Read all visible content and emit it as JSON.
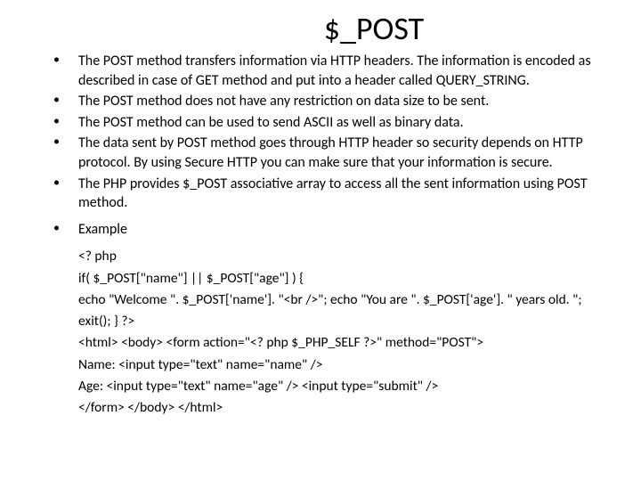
{
  "title": "$_POST",
  "bullets": [
    "The POST method transfers information via HTTP headers. The information is encoded as described in case of GET method and put into a header called QUERY_STRING.",
    "The POST method does not have any restriction on data size to be sent.",
    "The POST method can be used to send ASCII as well as binary data.",
    "The data sent by POST method goes through HTTP header so security depends on HTTP protocol. By using Secure HTTP you can make sure that your information is secure.",
    "The PHP provides $_POST associative array to access all the sent information using POST method."
  ],
  "example_label": "Example",
  "code_lines": [
    "<? php",
    "if( $_POST[\"name\"] || $_POST[\"age\"] ) {",
    "echo \"Welcome \". $_POST['name']. \"<br />\"; echo \"You are \". $_POST['age']. \" years old. \";",
    "exit(); } ?>",
    "<html> <body> <form action=\"<? php $_PHP_SELF ?>\" method=\"POST\">",
    "Name: <input type=\"text\" name=\"name\" />",
    "Age: <input type=\"text\" name=\"age\" /> <input type=\"submit\" />",
    "</form> </body> </html>"
  ]
}
